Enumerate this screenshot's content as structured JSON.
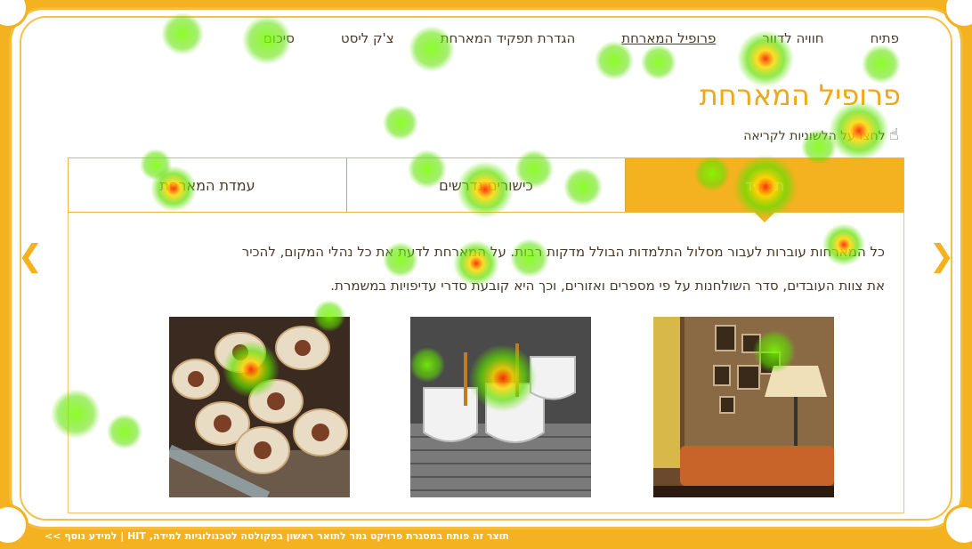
{
  "nav": {
    "items": [
      "פתיח",
      "חוויה לדוור",
      "פרופיל המארחת",
      "הגדרת תפקיד המארחת",
      "צ'ק ליסט",
      "סיכום"
    ],
    "active_index": 2
  },
  "page": {
    "title": "פרופיל המארחת",
    "subtitle": "לחצו על הלשוניות לקריאה"
  },
  "tabs": [
    {
      "label": "תפקיד",
      "active": true
    },
    {
      "label": "כישורים נדרשים",
      "active": false
    },
    {
      "label": "עמדת המארחת",
      "active": false
    }
  ],
  "content": {
    "line1": "כל המארחות עוברות לעבור מסלול התלמדות הבולל מדקות רבות. על המארחת לדעת את כל נהלי המקום, להכיר",
    "line2": "את  צוות העובדים, סדר השולחנות על פי מספרים ואזורים, וכך היא קובעת סדרי עדיפויות במשמרת."
  },
  "images": [
    {
      "name": "cafe-interior",
      "alt": "cafe interior"
    },
    {
      "name": "coffee-cups",
      "alt": "coffee cups"
    },
    {
      "name": "pastries",
      "alt": "pastries"
    }
  ],
  "footer": {
    "text": "תוצר זה פותח במסגרת פרויקט גמר לתואר ראשון בפקולטה לטכנולוגיות למידה, HIT | למידע נוסף >>"
  },
  "colors": {
    "accent": "#f4b120",
    "text": "#4a3a2a",
    "title": "#f0a81a"
  }
}
